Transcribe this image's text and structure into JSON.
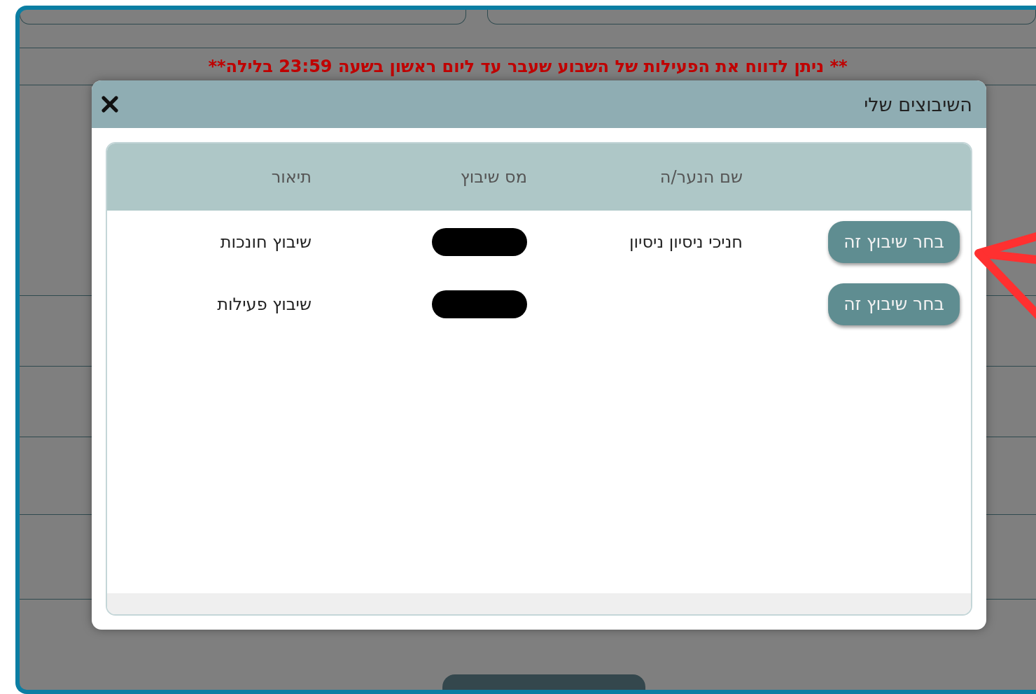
{
  "notice": "** ניתן לדווח את הפעילות של השבוע שעבר עד ליום ראשון בשעה 23:59 בלילה**",
  "modal": {
    "title": "השיבוצים שלי",
    "columns": [
      {
        "label": "שם הנער/ה"
      },
      {
        "label": "מס שיבוץ"
      },
      {
        "label": "תיאור"
      }
    ],
    "rows": [
      {
        "button": "בחר שיבוץ זה",
        "name": "חניכי ניסיון ניסיון",
        "number_redacted": true,
        "description": "שיבוץ חונכות"
      },
      {
        "button": "בחר שיבוץ זה",
        "number_redacted": true,
        "description": "שיבוץ פעילות"
      }
    ]
  },
  "annotation": {
    "kind": "arrow"
  }
}
